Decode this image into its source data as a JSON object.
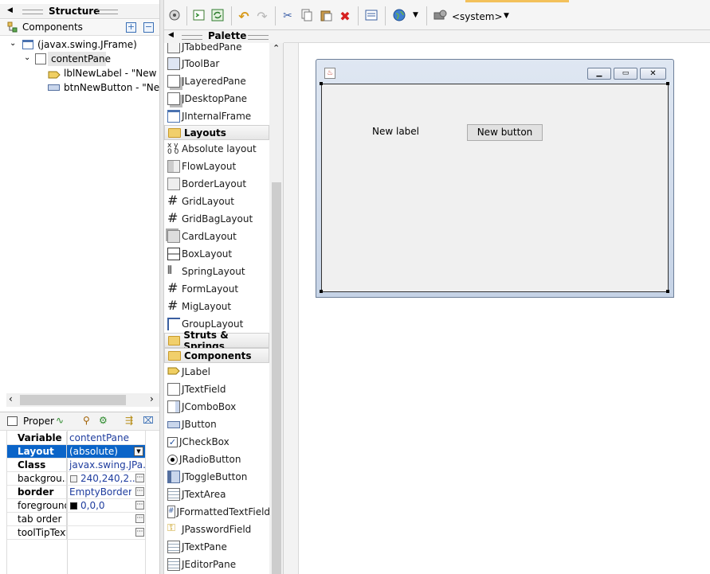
{
  "structure": {
    "title": "Structure",
    "components_label": "Components",
    "tree": {
      "frame": "(javax.swing.JFrame)",
      "content_pane": "contentPane",
      "label_node": "lblNewLabel - \"New la",
      "button_node": "btnNewButton - \"New"
    }
  },
  "properties": {
    "title": "Proper",
    "rows": [
      {
        "key": "Variable",
        "value": "contentPane"
      },
      {
        "key": "Layout",
        "value": "(absolute)"
      },
      {
        "key": "Class",
        "value": "javax.swing.JPa..."
      },
      {
        "key": "backgrou...",
        "value": "240,240,2..."
      },
      {
        "key": "border",
        "value": "EmptyBorder"
      },
      {
        "key": "foreground",
        "value": "0,0,0"
      },
      {
        "key": "tab order",
        "value": ""
      },
      {
        "key": "toolTipText",
        "value": ""
      }
    ]
  },
  "toolbar": {
    "look_and_feel": "<system>"
  },
  "palette": {
    "title": "Palette",
    "items_top": [
      "JTabbedPane",
      "JToolBar",
      "JLayeredPane",
      "JDesktopPane",
      "JInternalFrame"
    ],
    "cat_layouts": "Layouts",
    "layouts": [
      "Absolute layout",
      "FlowLayout",
      "BorderLayout",
      "GridLayout",
      "GridBagLayout",
      "CardLayout",
      "BoxLayout",
      "SpringLayout",
      "FormLayout",
      "MigLayout",
      "GroupLayout"
    ],
    "cat_struts": "Struts & Springs",
    "cat_components": "Components",
    "components": [
      "JLabel",
      "JTextField",
      "JComboBox",
      "JButton",
      "JCheckBox",
      "JRadioButton",
      "JToggleButton",
      "JTextArea",
      "JFormattedTextField",
      "JPasswordField",
      "JTextPane",
      "JEditorPane"
    ]
  },
  "design": {
    "label_text": "New label",
    "button_text": "New button"
  }
}
